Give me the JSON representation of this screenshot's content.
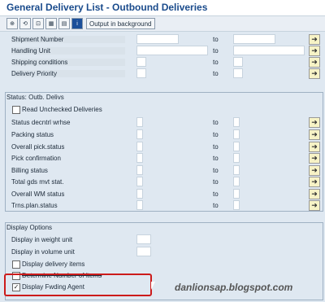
{
  "title": "General Delivery List - Outbound Deliveries",
  "toolbar": {
    "output_in_background": "Output in background"
  },
  "selection": {
    "rows": [
      {
        "label": "Shipment Number",
        "to": "to"
      },
      {
        "label": "Handling Unit",
        "to": "to"
      },
      {
        "label": "Shipping conditions",
        "to": "to"
      },
      {
        "label": "Delivery Priority",
        "to": "to"
      }
    ]
  },
  "status_group": {
    "title": "Status: Outb. Delivs",
    "read_unchecked": "Read Unchecked Deliveries",
    "rows": [
      {
        "label": "Status decntrl wrhse",
        "to": "to"
      },
      {
        "label": "Packing status",
        "to": "to"
      },
      {
        "label": "Overall pick.status",
        "to": "to"
      },
      {
        "label": "Pick confirmation",
        "to": "to"
      },
      {
        "label": "Billing status",
        "to": "to"
      },
      {
        "label": "Total gds mvt stat.",
        "to": "to"
      },
      {
        "label": "Overall WM status",
        "to": "to"
      },
      {
        "label": "Trns.plan.status",
        "to": "to"
      }
    ]
  },
  "display_group": {
    "title": "Display Options",
    "weight_unit": "Display in weight unit",
    "volume_unit": "Display in volume unit",
    "delivery_items": "Display delivery items",
    "determine_items": "Determine Number of Items",
    "fwding_agent": "Display Fwding Agent",
    "fwding_agent_checked": true
  },
  "watermark": "danlionsap.blogspot.com"
}
